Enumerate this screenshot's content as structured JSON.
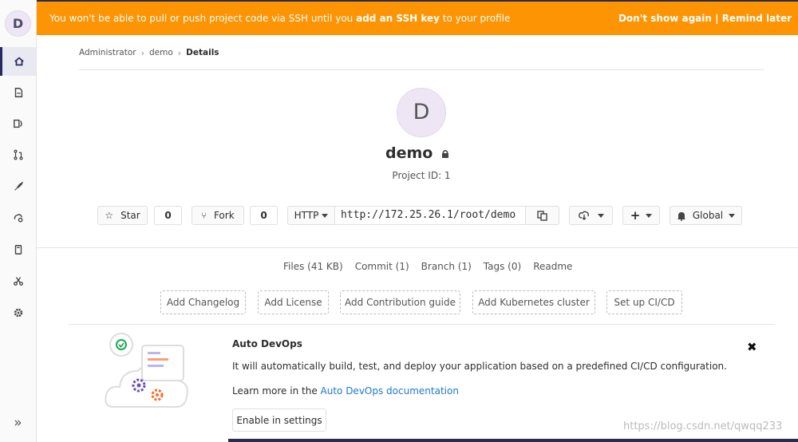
{
  "banner": {
    "message_pre": "You won't be able to pull or push project code via SSH until you ",
    "message_bold": "add an SSH key",
    "message_post": " to your profile",
    "dont_show": "Don't show again",
    "divider": " | ",
    "remind": "Remind later"
  },
  "sidebar": {
    "avatar_letter": "D",
    "items": [
      {
        "name": "home-icon",
        "active": true
      },
      {
        "name": "repository-icon",
        "active": false
      },
      {
        "name": "issues-icon",
        "active": false
      },
      {
        "name": "merge-request-icon",
        "active": false
      },
      {
        "name": "rocket-icon",
        "active": false
      },
      {
        "name": "operations-icon",
        "active": false
      },
      {
        "name": "wiki-icon",
        "active": false
      },
      {
        "name": "snippets-icon",
        "active": false
      },
      {
        "name": "settings-icon",
        "active": false
      }
    ],
    "collapse": "»"
  },
  "breadcrumb": {
    "items": [
      "Administrator",
      "demo"
    ],
    "current": "Details",
    "sep": "›"
  },
  "project": {
    "avatar_letter": "D",
    "name": "demo",
    "id_label": "Project ID: 1"
  },
  "controls": {
    "star_label": "Star",
    "star_count": "0",
    "fork_label": "Fork",
    "fork_count": "0",
    "protocol": "HTTP",
    "clone_url": "http://172.25.26.1/root/demo",
    "notification": "Global"
  },
  "stats": [
    "Files (41 KB)",
    "Commit (1)",
    "Branch (1)",
    "Tags (0)",
    "Readme"
  ],
  "quick_actions": [
    "Add Changelog",
    "Add License",
    "Add Contribution guide",
    "Add Kubernetes cluster",
    "Set up CI/CD"
  ],
  "auto_devops": {
    "title": "Auto DevOps",
    "description": "It will automatically build, test, and deploy your application based on a predefined CI/CD configuration.",
    "more_pre": "Learn more in the ",
    "more_link": "Auto DevOps documentation",
    "enable": "Enable in settings",
    "close": "✖"
  },
  "watermark": "https://blog.csdn.net/qwqq233",
  "colors": {
    "banner": "#fc9403",
    "link": "#1f78d1",
    "sidebar_active": "#292961"
  }
}
